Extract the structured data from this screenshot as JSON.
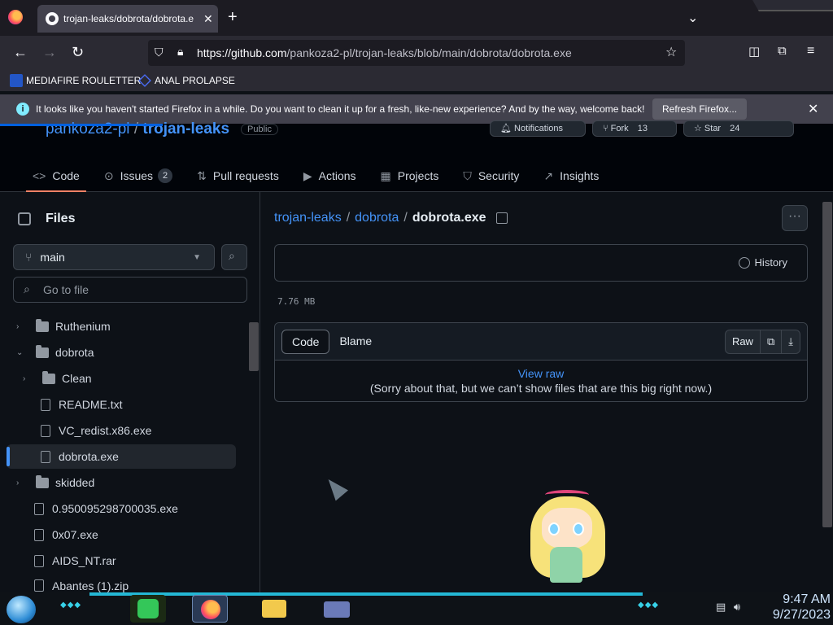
{
  "browser": {
    "tab_title": "trojan-leaks/dobrota/dobrota.e",
    "url_domain": "https://github.com",
    "url_path": "/pankoza2-pl/trojan-leaks/blob/main/dobrota/dobrota.exe",
    "bookmarks": [
      {
        "label": "MEDIAFIRE ROULETTER",
        "icon": "mediafire-icon"
      },
      {
        "label": "ANAL PROLAPSE",
        "icon": "bookmark-icon"
      }
    ],
    "notification": {
      "text": "It looks like you haven't started Firefox in a while. Do you want to clean it up for a fresh, like-new experience? And by the way, welcome back!",
      "button": "Refresh Firefox..."
    }
  },
  "repo": {
    "owner": "pankoza2-pl",
    "sep": "/",
    "name": "trojan-leaks",
    "visibility": "Public",
    "notifications": "Notifications",
    "fork_label": "Fork",
    "fork_count": "13",
    "star_label": "Star",
    "star_count": "24",
    "tabs": [
      {
        "label": "Code",
        "icon": "code-icon"
      },
      {
        "label": "Issues",
        "icon": "issue-icon",
        "count": "2"
      },
      {
        "label": "Pull requests",
        "icon": "pull-request-icon"
      },
      {
        "label": "Actions",
        "icon": "play-icon"
      },
      {
        "label": "Projects",
        "icon": "table-icon"
      },
      {
        "label": "Security",
        "icon": "shield-icon"
      },
      {
        "label": "Insights",
        "icon": "graph-icon"
      }
    ]
  },
  "sidebar": {
    "title": "Files",
    "branch": "main",
    "goto_placeholder": "Go to file",
    "tree": [
      {
        "label": "Ruthenium",
        "type": "folder",
        "expanded": false
      },
      {
        "label": "dobrota",
        "type": "folder",
        "expanded": true
      },
      {
        "label": "Clean",
        "type": "folder",
        "expanded": false
      },
      {
        "label": "README.txt",
        "type": "file"
      },
      {
        "label": "VC_redist.x86.exe",
        "type": "file"
      },
      {
        "label": "dobrota.exe",
        "type": "file",
        "selected": true
      },
      {
        "label": "skidded",
        "type": "folder",
        "expanded": false
      },
      {
        "label": "0.950095298700035.exe",
        "type": "file"
      },
      {
        "label": "0x07.exe",
        "type": "file"
      },
      {
        "label": "AIDS_NT.rar",
        "type": "file"
      },
      {
        "label": "Abantes (1).zip",
        "type": "file"
      }
    ]
  },
  "main": {
    "crumb_repo": "trojan-leaks",
    "crumb_dir": "dobrota",
    "crumb_file": "dobrota.exe",
    "history": "History",
    "size": "7.76 MB",
    "tab_code": "Code",
    "tab_blame": "Blame",
    "raw": "Raw",
    "view_raw": "View raw",
    "too_big": "(Sorry about that, but we can’t show files that are this big right now.)"
  },
  "overlay": {
    "character": "cartoon-character"
  },
  "taskbar": {
    "time": "9:47 AM",
    "date": "9/27/2023"
  },
  "colors": {
    "accent": "#4493f8",
    "tab_underline": "#f78166",
    "bg": "#0d1117"
  }
}
